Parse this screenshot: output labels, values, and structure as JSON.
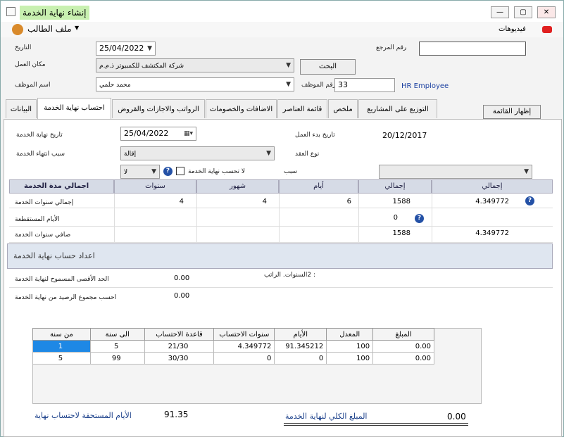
{
  "window": {
    "title": "إنشاء نهاية الخدمة",
    "minimize": "—",
    "maximize": "▢",
    "close": "✕"
  },
  "menu": {
    "videos": "فيديوهات",
    "profile": "ملف الطالب"
  },
  "form": {
    "date_label": "التاريخ",
    "date_value": "25/04/2022",
    "ref_label": "رقم المرجع",
    "ref_value": "",
    "workplace_label": "مكان العمل",
    "workplace_value": "شركة المكتشف للكمبيوتر ذ.م.م",
    "search_button": "البحث",
    "emp_name_label": "اسم الموظف",
    "emp_name_value": "محمد حلمي",
    "emp_no_label": "رقم الموظف",
    "emp_no_value": "33",
    "emp_code": "HR Employee"
  },
  "tabs": [
    "البيانات",
    "احتساب نهاية الخدمة",
    "الرواتب والاجازات والقروض",
    "الاضافات والخصومات",
    "قائمة العناصر",
    "ملخص",
    "التوزيع على المشاريع"
  ],
  "show_list_button": "إظهار القائمة",
  "calc": {
    "end_date_label": "تاريخ نهاية الخدمة",
    "end_date_value": "25/04/2022",
    "end_reason_label": "سبب انتهاء الخدمة",
    "end_reason_value": "إقالة",
    "start_date_label": "تاريخ بدء العمل",
    "start_date_value": "20/12/2017",
    "contract_label": "نوع العقد",
    "no_calc_label": "لا تحسب نهاية الخدمة",
    "no_calc_value": "لا",
    "reason_label": "سبب"
  },
  "grid": {
    "headers": {
      "total_service": "اجمالي مدة الخدمة",
      "years": "سنوات",
      "months": "شهور",
      "days": "أيام",
      "total1": "إجمالي",
      "total2": "إجمالي"
    },
    "rows": [
      {
        "label": "إجمالي سنوات الخدمة",
        "years": "4",
        "months": "4",
        "days": "6",
        "total1": "1588",
        "total2": "4.349772"
      },
      {
        "label": "الأيام المستقطعة",
        "years": "",
        "months": "",
        "days": "",
        "total1": "0",
        "total2": ""
      },
      {
        "label": "صافي سنوات الخدمة",
        "years": "",
        "months": "",
        "days": "",
        "total1": "1588",
        "total2": "4.349772"
      }
    ]
  },
  "section_title": "اعداد حساب نهاية الخدمة",
  "settings": {
    "max_label": "الحد الأقصى المسموح لنهاية الخدمة",
    "max_value": "0.00",
    "balance_label": "احسب مجموع الرصيد من نهاية الخدمة",
    "balance_value": "0.00",
    "salary_note": ": 2السنوات. الراتب"
  },
  "table": {
    "columns": [
      "من سنة",
      "الى سنة",
      "قاعدة الاحتساب",
      "سنوات الاحتساب",
      "الأيام",
      "المعدل",
      "المبلغ"
    ],
    "rows": [
      [
        "1",
        "5",
        "21/30",
        "4.349772",
        "91.345212",
        "100",
        "0.00"
      ],
      [
        "5",
        "99",
        "30/30",
        "0",
        "0",
        "100",
        "0.00"
      ]
    ]
  },
  "footer": {
    "days_label": "الأيام المستحقة لاحتساب نهاية",
    "days_value": "91.35",
    "total_label": "المبلغ الكلي لنهاية الخدمة",
    "total_value": "0.00"
  },
  "colors": {
    "title_bg": "#c8f0b0",
    "selected_cell": "#1e88e5",
    "header_bg": "#d6dbe6",
    "accent": "#2451a6"
  }
}
